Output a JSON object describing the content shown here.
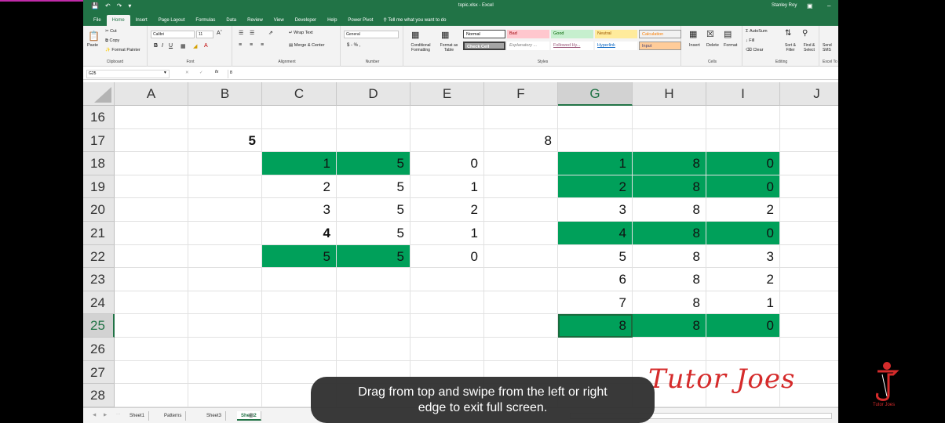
{
  "window": {
    "title": "topic.xlsx - Excel",
    "user": "Stanley Roy"
  },
  "tabs": [
    "File",
    "Home",
    "Insert",
    "Page Layout",
    "Formulas",
    "Data",
    "Review",
    "View",
    "Developer",
    "Help",
    "Power Pivot"
  ],
  "tell_me": "Tell me what you want to do",
  "ribbon": {
    "clipboard": {
      "paste": "Paste",
      "cut": "Cut",
      "copy": "Copy",
      "format_painter": "Format Painter",
      "label": "Clipboard"
    },
    "font": {
      "name": "Calibri",
      "size": "11",
      "label": "Font"
    },
    "alignment": {
      "wrap": "Wrap Text",
      "merge": "Merge & Center",
      "label": "Alignment"
    },
    "number": {
      "format": "General",
      "currency": "$ - % ,",
      "label": "Number"
    },
    "styles": {
      "conditional": "Conditional Formatting",
      "format_table": "Format as Table",
      "label": "Styles",
      "items": [
        {
          "name": "Normal",
          "bg": "#ffffff",
          "fg": "#000000"
        },
        {
          "name": "Bad",
          "bg": "#ffc7ce",
          "fg": "#9c0006"
        },
        {
          "name": "Good",
          "bg": "#c6efce",
          "fg": "#006100"
        },
        {
          "name": "Neutral",
          "bg": "#ffeb9c",
          "fg": "#9c5700"
        },
        {
          "name": "Calculation",
          "bg": "#f2f2f2",
          "fg": "#fa7d00"
        },
        {
          "name": "Check Cell",
          "bg": "#a5a5a5",
          "fg": "#ffffff"
        },
        {
          "name": "Explanatory ...",
          "bg": "#ffffff",
          "fg": "#7f7f7f"
        },
        {
          "name": "Followed Hy...",
          "bg": "#ffffff",
          "fg": "#954f72"
        },
        {
          "name": "Hyperlink",
          "bg": "#ffffff",
          "fg": "#0563c1"
        },
        {
          "name": "Input",
          "bg": "#ffcc99",
          "fg": "#3f3f76"
        }
      ]
    },
    "cells": {
      "insert": "Insert",
      "delete": "Delete",
      "format": "Format",
      "label": "Cells"
    },
    "editing": {
      "autosum": "AutoSum",
      "fill": "Fill",
      "clear": "Clear",
      "sort": "Sort & Filter",
      "find": "Find & Select",
      "label": "Editing"
    },
    "extra": {
      "send": "Send SMS",
      "label": "Excel To"
    }
  },
  "formula_bar": {
    "name_box": "G25",
    "fx": "fx",
    "value": "8"
  },
  "columns": [
    "A",
    "B",
    "C",
    "D",
    "E",
    "F",
    "G",
    "H",
    "I",
    "J"
  ],
  "selected_column": "G",
  "selected_row": "25",
  "rows": [
    {
      "num": "16",
      "cells": {}
    },
    {
      "num": "17",
      "cells": {
        "B": {
          "v": "5",
          "bold": true
        },
        "F": {
          "v": "8"
        }
      }
    },
    {
      "num": "18",
      "cells": {
        "C": {
          "v": "1",
          "g": true
        },
        "D": {
          "v": "5",
          "g": true
        },
        "E": {
          "v": "0"
        },
        "G": {
          "v": "1",
          "g": true
        },
        "H": {
          "v": "8",
          "g": true
        },
        "I": {
          "v": "0",
          "g": true
        }
      }
    },
    {
      "num": "19",
      "cells": {
        "C": {
          "v": "2"
        },
        "D": {
          "v": "5"
        },
        "E": {
          "v": "1"
        },
        "G": {
          "v": "2",
          "g": true
        },
        "H": {
          "v": "8",
          "g": true
        },
        "I": {
          "v": "0",
          "g": true
        }
      }
    },
    {
      "num": "20",
      "cells": {
        "C": {
          "v": "3"
        },
        "D": {
          "v": "5"
        },
        "E": {
          "v": "2"
        },
        "G": {
          "v": "3"
        },
        "H": {
          "v": "8"
        },
        "I": {
          "v": "2"
        }
      }
    },
    {
      "num": "21",
      "cells": {
        "C": {
          "v": "4",
          "bold": true
        },
        "D": {
          "v": "5"
        },
        "E": {
          "v": "1"
        },
        "G": {
          "v": "4",
          "g": true
        },
        "H": {
          "v": "8",
          "g": true
        },
        "I": {
          "v": "0",
          "g": true
        }
      }
    },
    {
      "num": "22",
      "cells": {
        "C": {
          "v": "5",
          "g": true
        },
        "D": {
          "v": "5",
          "g": true
        },
        "E": {
          "v": "0"
        },
        "G": {
          "v": "5"
        },
        "H": {
          "v": "8"
        },
        "I": {
          "v": "3"
        }
      }
    },
    {
      "num": "23",
      "cells": {
        "G": {
          "v": "6"
        },
        "H": {
          "v": "8"
        },
        "I": {
          "v": "2"
        }
      }
    },
    {
      "num": "24",
      "cells": {
        "G": {
          "v": "7"
        },
        "H": {
          "v": "8"
        },
        "I": {
          "v": "1"
        }
      }
    },
    {
      "num": "25",
      "cells": {
        "G": {
          "v": "8",
          "g": true,
          "active": true
        },
        "H": {
          "v": "8",
          "g": true
        },
        "I": {
          "v": "0",
          "g": true
        }
      }
    },
    {
      "num": "26",
      "cells": {}
    },
    {
      "num": "27",
      "cells": {}
    },
    {
      "num": "28",
      "cells": {}
    }
  ],
  "sheets": [
    "Sheet1",
    "Patterns",
    "Sheet3",
    "Sheet2"
  ],
  "active_sheet": "Sheet2",
  "toast": {
    "line1": "Drag from top and swipe from the left or right",
    "line2": "edge to exit full screen."
  },
  "watermark": "Tutor Joes",
  "logo_label": "Tutor Joes",
  "colors": {
    "excel_green": "#217346",
    "cell_fill": "#00a05a",
    "watermark_red": "#d52b2b"
  }
}
